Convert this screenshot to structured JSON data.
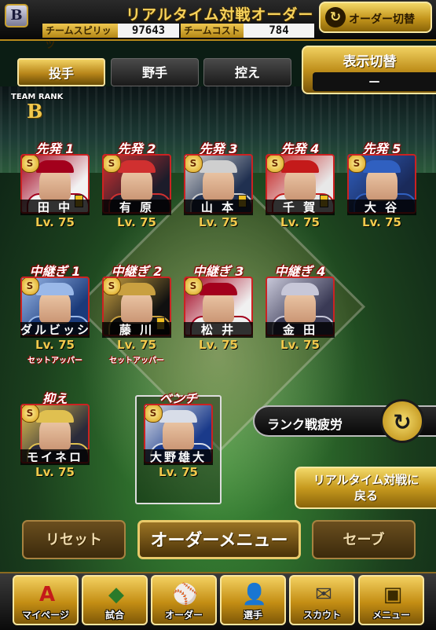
{
  "header": {
    "title": "リアルタイム対戦オーダー",
    "team_logo": "B",
    "order_switch_label": "オーダー切替",
    "team_spirit_label": "チームスピリッツ",
    "team_spirit": "97643",
    "team_cost_label": "チームコスト",
    "team_cost": "784"
  },
  "tabs": [
    {
      "label": "投手",
      "active": true
    },
    {
      "label": "野手",
      "active": false
    },
    {
      "label": "控え",
      "active": false
    }
  ],
  "display_switch": {
    "label": "表示切替",
    "value": "—"
  },
  "team_rank": {
    "label": "TEAM RANK",
    "rank": "B"
  },
  "starters": [
    {
      "position": "先発 1",
      "name": "田 中",
      "level": "Lv. 75",
      "badge": "S",
      "team_colors": [
        "#f2f2f2",
        "#a3001c"
      ]
    },
    {
      "position": "先発 2",
      "name": "有 原",
      "level": "Lv. 75",
      "badge": "S",
      "team_colors": [
        "#1c1c2a",
        "#d03030"
      ]
    },
    {
      "position": "先発 3",
      "name": "山 本",
      "level": "Lv. 75",
      "badge": "S",
      "team_colors": [
        "#203050",
        "#cfcfcf"
      ]
    },
    {
      "position": "先発 4",
      "name": "千 賀",
      "level": "Lv. 75",
      "badge": "S",
      "team_colors": [
        "#e8e8e8",
        "#c41a1a"
      ]
    },
    {
      "position": "先発 5",
      "name": "大 谷",
      "level": "Lv. 75",
      "badge": "S",
      "team_colors": [
        "#1a2a5a",
        "#3060c0"
      ]
    }
  ],
  "relievers": [
    {
      "position": "中継ぎ 1",
      "name": "ダルビッシュ",
      "level": "Lv. 75",
      "badge": "S",
      "role": "セットアッパー",
      "team_colors": [
        "#1a3a7a",
        "#9ab8e8"
      ]
    },
    {
      "position": "中継ぎ 2",
      "name": "藤 川",
      "level": "Lv. 75",
      "badge": "S",
      "role": "セットアッパー",
      "team_colors": [
        "#101010",
        "#c9a040"
      ]
    },
    {
      "position": "中継ぎ 3",
      "name": "松 井",
      "level": "Lv. 75",
      "badge": "S",
      "role": "",
      "team_colors": [
        "#f0f0f0",
        "#a3001c"
      ]
    },
    {
      "position": "中継ぎ 4",
      "name": "金 田",
      "level": "Lv. 75",
      "badge": "",
      "role": "",
      "team_colors": [
        "#3a3a55",
        "#c7c7d8"
      ]
    }
  ],
  "closer": {
    "position": "抑え",
    "name": "モイネロ",
    "level": "Lv. 75",
    "badge": "S",
    "team_colors": [
      "#2a2a3a",
      "#e0c050"
    ]
  },
  "bench": {
    "position": "ベンチ",
    "name": "大野雄大",
    "level": "Lv. 75",
    "badge": "S",
    "team_colors": [
      "#1a3a8a",
      "#d8dde8"
    ]
  },
  "rank_fatigue_label": "ランク戦疲労",
  "back_to_realtime": {
    "line1": "リアルタイム対戦に",
    "line2": "戻る"
  },
  "actions": {
    "reset": "リセット",
    "order_menu": "オーダーメニュー",
    "save": "セーブ"
  },
  "nav": [
    {
      "label": "マイページ",
      "icon": "A"
    },
    {
      "label": "試合",
      "icon": "◆"
    },
    {
      "label": "オーダー",
      "icon": "⚾"
    },
    {
      "label": "選手",
      "icon": "👤"
    },
    {
      "label": "スカウト",
      "icon": "✉"
    },
    {
      "label": "メニュー",
      "icon": "▣"
    }
  ],
  "colors": {
    "gold": "#f2c94c",
    "position_red": "#b00000",
    "bench_white": "#dddddd"
  }
}
